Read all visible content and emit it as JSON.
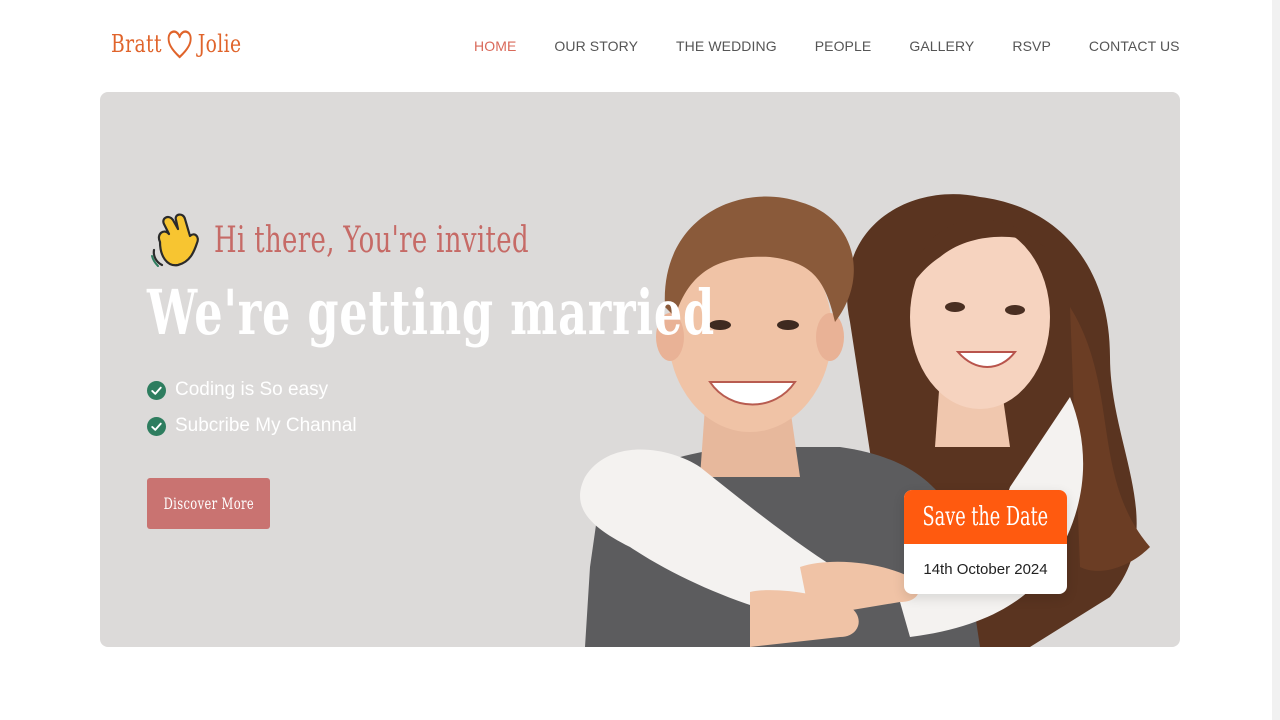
{
  "brand": {
    "name_left": "Bratt",
    "name_right": "Jolie",
    "color": "#e0642b",
    "icon": "heart-outline-icon"
  },
  "nav": {
    "items": [
      {
        "label": "HOME",
        "active": true
      },
      {
        "label": "OUR STORY",
        "active": false
      },
      {
        "label": "THE WEDDING",
        "active": false
      },
      {
        "label": "PEOPLE",
        "active": false
      },
      {
        "label": "GALLERY",
        "active": false
      },
      {
        "label": "RSVP",
        "active": false
      },
      {
        "label": "CONTACT US",
        "active": false
      }
    ],
    "active_color": "#d9695a"
  },
  "hero": {
    "greeting": "Hi there, You're invited",
    "greeting_icon": "waving-hand-icon",
    "headline": "We're getting married",
    "features": [
      "Coding is So easy",
      "Subcribe My Channal"
    ],
    "cta_label": "Discover More",
    "background": "#dcdad9",
    "accent": "#c97371",
    "check_color": "#2e7d5f"
  },
  "save_the_date": {
    "title": "Save the Date",
    "date": "14th October 2024",
    "color": "#ff5a0f"
  }
}
